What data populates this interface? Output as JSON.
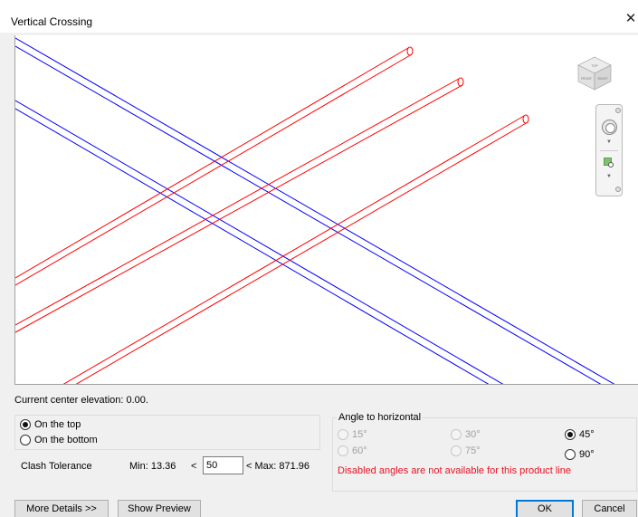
{
  "window": {
    "title": "Vertical Crossing",
    "close_glyph": "✕"
  },
  "viewport": {
    "blue_color": "#0000ff",
    "red_color": "#ff0000",
    "viewcube_faces": [
      "FRONT",
      "RIGHT",
      "TOP"
    ]
  },
  "elevation_text": "Current center elevation: 0.00.",
  "position": {
    "options": [
      {
        "label": "On the top",
        "selected": true
      },
      {
        "label": "On the bottom",
        "selected": false
      }
    ]
  },
  "clash": {
    "label": "Clash Tolerance",
    "min_text": "Min: 13.36",
    "lt_symbol": "<",
    "value": "50",
    "max_text": "< Max: 871.96"
  },
  "angle": {
    "title": "Angle to horizontal",
    "options": [
      {
        "label": "15°",
        "enabled": false,
        "selected": false
      },
      {
        "label": "30°",
        "enabled": false,
        "selected": false
      },
      {
        "label": "45°",
        "enabled": true,
        "selected": true
      },
      {
        "label": "60°",
        "enabled": false,
        "selected": false
      },
      {
        "label": "75°",
        "enabled": false,
        "selected": false
      },
      {
        "label": "90°",
        "enabled": true,
        "selected": false
      }
    ],
    "warning": "Disabled angles are not available for this product line",
    "warning_color": "#e81123"
  },
  "buttons": {
    "more_details": "More Details >>",
    "show_preview": "Show Preview",
    "ok": "OK",
    "cancel": "Cancel"
  }
}
